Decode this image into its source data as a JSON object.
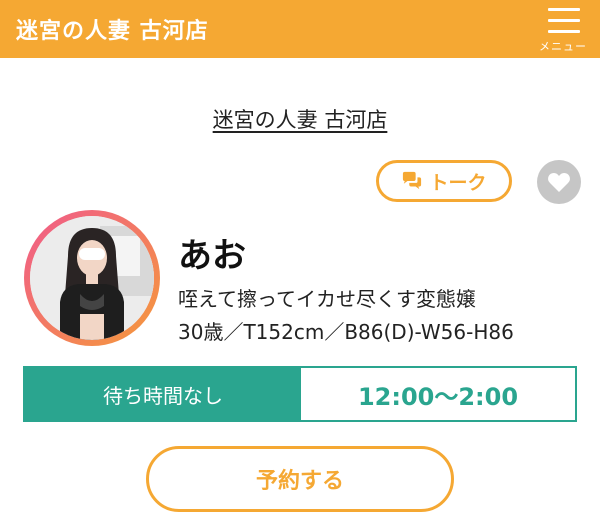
{
  "header": {
    "title": "迷宮の人妻 古河店",
    "menu_label": "メニュー"
  },
  "shop_link": "迷宮の人妻 古河店",
  "talk_button": {
    "label": "トーク",
    "icon": "chat-bubbles-icon"
  },
  "favorite_button": {
    "icon": "heart-icon"
  },
  "profile": {
    "name": "あお",
    "catchphrase": "咥えて擦ってイカせ尽くす変態嬢",
    "details": "30歳／T152cm／B86(D)-W56-H86"
  },
  "status": {
    "wait": "待ち時間なし",
    "hours": "12:00〜2:00"
  },
  "reserve_button": {
    "label": "予約する"
  },
  "colors": {
    "brand_orange": "#f5a833",
    "status_teal": "#2aa58f",
    "favorite_gray": "#c6c6c6"
  }
}
